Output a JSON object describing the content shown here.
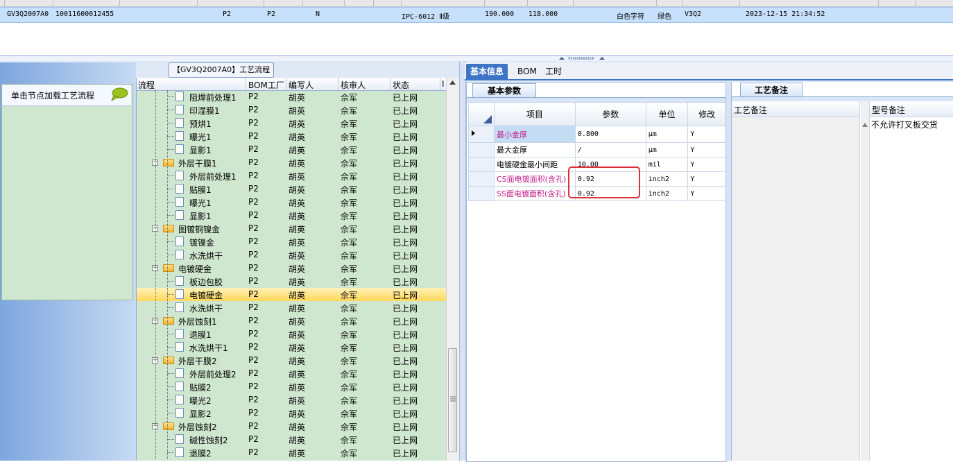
{
  "top_row": {
    "part_no": "GV3Q2007A0",
    "serial": "10011600012455",
    "col_p2a": "P2",
    "col_p2b": "P2",
    "col_n": "N",
    "spec": "IPC-6012 Ⅱ级",
    "v1": "190.000",
    "v2": "118.000",
    "text_color": "白色字符",
    "ink_color": "绿色",
    "version": "V3Q2",
    "datetime": "2023-12-15 21:34:52"
  },
  "left_panel": {
    "node_hint": "单击节点加载工艺流程",
    "icon": "speech-bubble-icon"
  },
  "process_title": "【GV3Q2007A0】工艺流程",
  "tree": {
    "headers": [
      "流程",
      "BOM工厂",
      "编写人",
      "核审人",
      "状态",
      "I"
    ],
    "rows": [
      {
        "name": "阻焊前处理1",
        "level": 2,
        "factory": "P2",
        "writer": "胡英",
        "reviewer": "佘军",
        "status": "已上网"
      },
      {
        "name": "印湿膜1",
        "level": 2,
        "factory": "P2",
        "writer": "胡英",
        "reviewer": "佘军",
        "status": "已上网"
      },
      {
        "name": "预烘1",
        "level": 2,
        "factory": "P2",
        "writer": "胡英",
        "reviewer": "佘军",
        "status": "已上网"
      },
      {
        "name": "曝光1",
        "level": 2,
        "factory": "P2",
        "writer": "胡英",
        "reviewer": "佘军",
        "status": "已上网"
      },
      {
        "name": "显影1",
        "level": 2,
        "factory": "P2",
        "writer": "胡英",
        "reviewer": "佘军",
        "status": "已上网"
      },
      {
        "name": "外层干膜1",
        "level": 1,
        "factory": "P2",
        "writer": "胡英",
        "reviewer": "佘军",
        "status": "已上网"
      },
      {
        "name": "外层前处理1",
        "level": 2,
        "factory": "P2",
        "writer": "胡英",
        "reviewer": "佘军",
        "status": "已上网"
      },
      {
        "name": "贴膜1",
        "level": 2,
        "factory": "P2",
        "writer": "胡英",
        "reviewer": "佘军",
        "status": "已上网"
      },
      {
        "name": "曝光1",
        "level": 2,
        "factory": "P2",
        "writer": "胡英",
        "reviewer": "佘军",
        "status": "已上网"
      },
      {
        "name": "显影1",
        "level": 2,
        "factory": "P2",
        "writer": "胡英",
        "reviewer": "佘军",
        "status": "已上网"
      },
      {
        "name": "图镀铜镍金",
        "level": 1,
        "factory": "P2",
        "writer": "胡英",
        "reviewer": "佘军",
        "status": "已上网"
      },
      {
        "name": "镀镍金",
        "level": 2,
        "factory": "P2",
        "writer": "胡英",
        "reviewer": "佘军",
        "status": "已上网"
      },
      {
        "name": "水洗烘干",
        "level": 2,
        "factory": "P2",
        "writer": "胡英",
        "reviewer": "佘军",
        "status": "已上网"
      },
      {
        "name": "电镀硬金",
        "level": 1,
        "factory": "P2",
        "writer": "胡英",
        "reviewer": "佘军",
        "status": "已上网"
      },
      {
        "name": "板边包胶",
        "level": 2,
        "factory": "P2",
        "writer": "胡英",
        "reviewer": "佘军",
        "status": "已上网"
      },
      {
        "name": "电镀硬金",
        "level": 2,
        "factory": "P2",
        "writer": "胡英",
        "reviewer": "佘军",
        "status": "已上网",
        "selected": true
      },
      {
        "name": "水洗烘干",
        "level": 2,
        "factory": "P2",
        "writer": "胡英",
        "reviewer": "佘军",
        "status": "已上网"
      },
      {
        "name": "外层蚀刻1",
        "level": 1,
        "factory": "P2",
        "writer": "胡英",
        "reviewer": "佘军",
        "status": "已上网"
      },
      {
        "name": "退膜1",
        "level": 2,
        "factory": "P2",
        "writer": "胡英",
        "reviewer": "佘军",
        "status": "已上网"
      },
      {
        "name": "水洗烘干1",
        "level": 2,
        "factory": "P2",
        "writer": "胡英",
        "reviewer": "佘军",
        "status": "已上网"
      },
      {
        "name": "外层干膜2",
        "level": 1,
        "factory": "P2",
        "writer": "胡英",
        "reviewer": "佘军",
        "status": "已上网"
      },
      {
        "name": "外层前处理2",
        "level": 2,
        "factory": "P2",
        "writer": "胡英",
        "reviewer": "佘军",
        "status": "已上网"
      },
      {
        "name": "贴膜2",
        "level": 2,
        "factory": "P2",
        "writer": "胡英",
        "reviewer": "佘军",
        "status": "已上网"
      },
      {
        "name": "曝光2",
        "level": 2,
        "factory": "P2",
        "writer": "胡英",
        "reviewer": "佘军",
        "status": "已上网"
      },
      {
        "name": "显影2",
        "level": 2,
        "factory": "P2",
        "writer": "胡英",
        "reviewer": "佘军",
        "status": "已上网"
      },
      {
        "name": "外层蚀刻2",
        "level": 1,
        "factory": "P2",
        "writer": "胡英",
        "reviewer": "佘军",
        "status": "已上网"
      },
      {
        "name": "碱性蚀刻2",
        "level": 2,
        "factory": "P2",
        "writer": "胡英",
        "reviewer": "佘军",
        "status": "已上网"
      },
      {
        "name": "退膜2",
        "level": 2,
        "factory": "P2",
        "writer": "胡英",
        "reviewer": "佘军",
        "status": "已上网"
      }
    ]
  },
  "tabs": [
    {
      "label": "基本信息",
      "active": true
    },
    {
      "label": "BOM",
      "active": false
    },
    {
      "label": "工时",
      "active": false
    }
  ],
  "basic": {
    "tab_label": "基本参数",
    "headers": [
      "项目",
      "参数",
      "单位",
      "修改"
    ],
    "rows": [
      {
        "item": "最小金厚",
        "value": "0.800",
        "unit": "μm",
        "edit": "Y",
        "pink": true,
        "current": true
      },
      {
        "item": "最大金厚",
        "value": "/",
        "unit": "μm",
        "edit": "Y",
        "pink": false,
        "current": false
      },
      {
        "item": "电镀硬金最小间距",
        "value": "10.00",
        "unit": "mil",
        "edit": "Y",
        "pink": false,
        "current": false
      },
      {
        "item": "CS面电镀面积(含孔)",
        "value": "0.92",
        "unit": "inch2",
        "edit": "Y",
        "pink": true,
        "current": false
      },
      {
        "item": "SS面电镀面积(含孔)",
        "value": "0.92",
        "unit": "inch2",
        "edit": "Y",
        "pink": true,
        "current": false
      }
    ]
  },
  "remark": {
    "tab_label": "工艺备注",
    "col1": "工艺备注",
    "col2": "型号备注",
    "model_remark": "不允许打叉板交货"
  },
  "colors": {
    "accent": "#3d74c6",
    "grid_green": "#cfe7cf",
    "selection": "#ffd75a",
    "highlight_box": "#d8323a",
    "pink_text": "#c0208a"
  }
}
